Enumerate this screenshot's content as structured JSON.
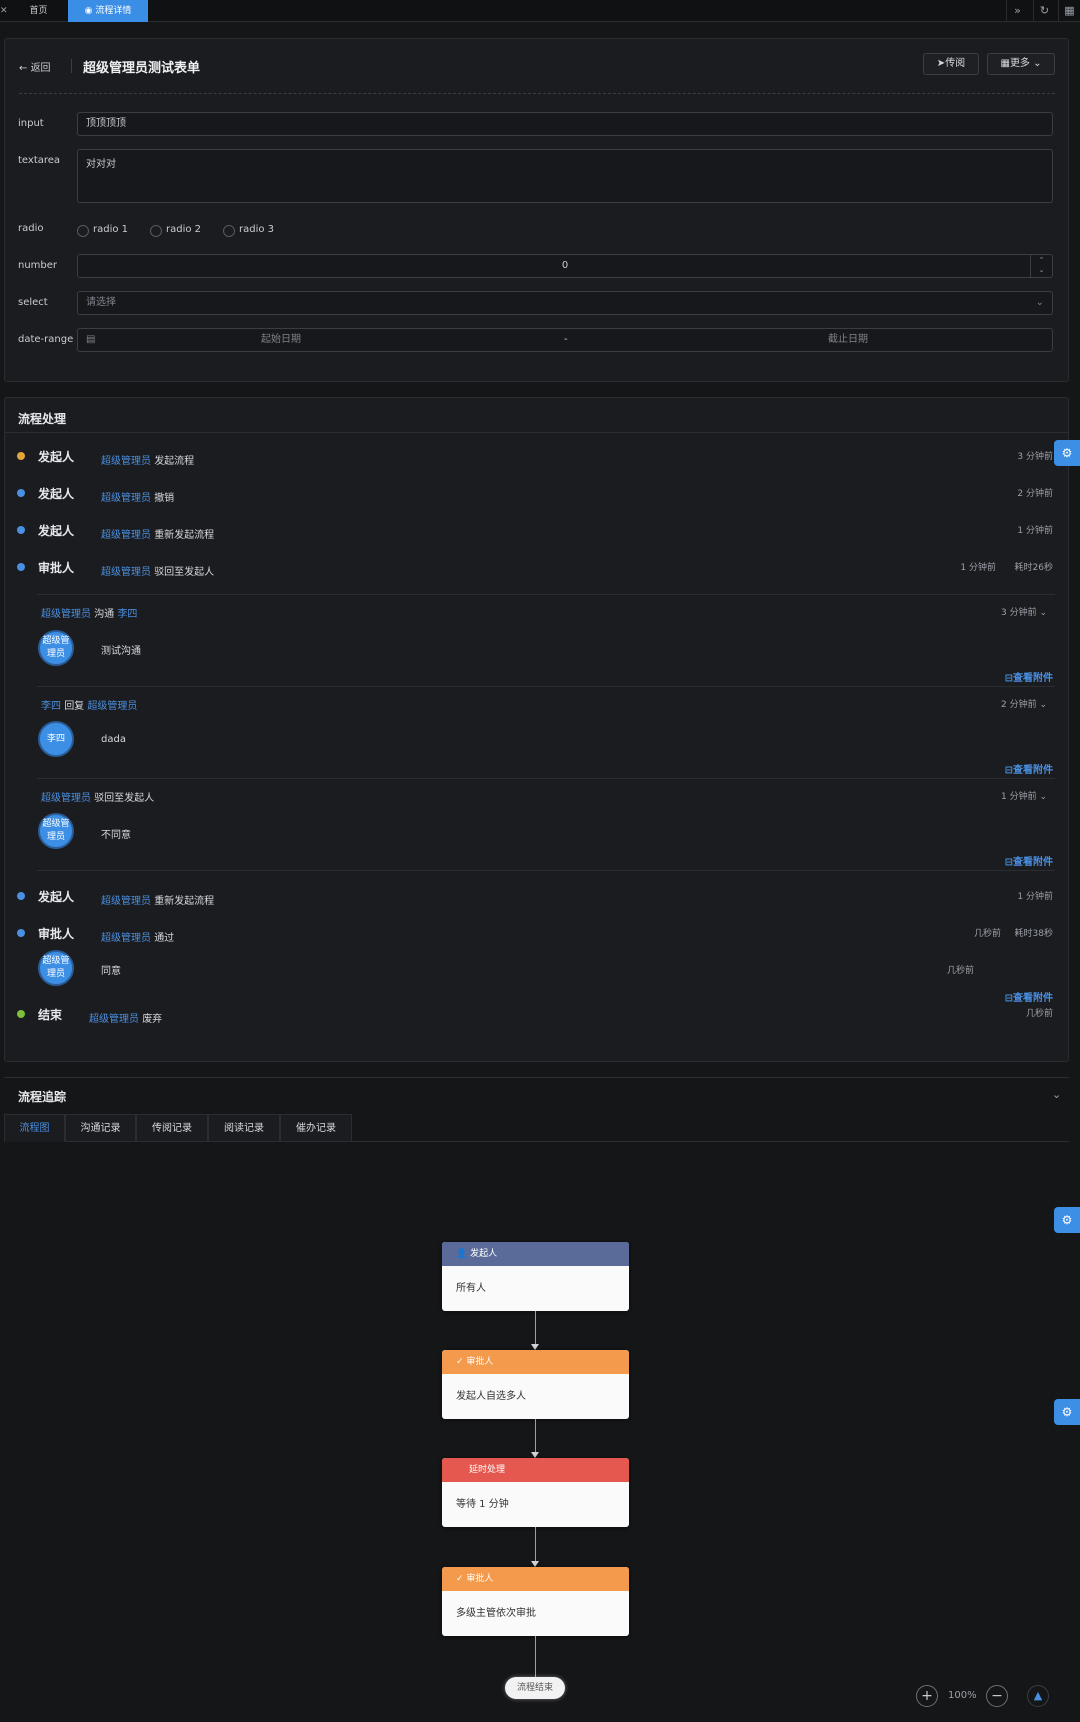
{
  "tabs": {
    "home": "首页",
    "active": "流程详情"
  },
  "header": {
    "back_label": "返回",
    "title": "超级管理员测试表单",
    "circulate_label": "传阅",
    "more_label": "更多"
  },
  "form": {
    "input": {
      "label": "input",
      "value": "顶顶顶顶"
    },
    "textarea": {
      "label": "textarea",
      "value": "对对对"
    },
    "radio": {
      "label": "radio",
      "options": [
        "radio 1",
        "radio 2",
        "radio 3"
      ]
    },
    "number": {
      "label": "number",
      "value": "0"
    },
    "select": {
      "label": "select",
      "placeholder": "请选择"
    },
    "date_range": {
      "label": "date-range",
      "start_placeholder": "起始日期",
      "separator": "-",
      "end_placeholder": "截止日期"
    }
  },
  "process": {
    "title": "流程处理",
    "attach_label": "查看附件",
    "entries": [
      {
        "role": "发起人",
        "user": "超级管理员",
        "action": "发起流程",
        "time": "3 分钟前",
        "color": "#e5a33b"
      },
      {
        "role": "发起人",
        "user": "超级管理员",
        "action": "撤销",
        "time": "2 分钟前",
        "color": "#4a90e2"
      },
      {
        "role": "发起人",
        "user": "超级管理员",
        "action": "重新发起流程",
        "time": "1 分钟前",
        "color": "#4a90e2"
      },
      {
        "role": "审批人",
        "user": "超级管理员",
        "action": "驳回至发起人",
        "time": "1 分钟前",
        "duration": "耗时26秒",
        "color": "#4a90e2"
      },
      {
        "role": "发起人",
        "user": "超级管理员",
        "action": "重新发起流程",
        "time": "1 分钟前",
        "color": "#4a90e2"
      },
      {
        "role": "审批人",
        "user": "超级管理员",
        "action": "通过",
        "time": "几秒前",
        "duration": "耗时38秒",
        "comment": "同意",
        "comment_time": "几秒前",
        "avatar": "超级管理员",
        "color": "#4a90e2"
      },
      {
        "role": "结束",
        "user": "超级管理员",
        "action": "废弃",
        "time": "几秒前",
        "color": "#7cbf3b"
      }
    ],
    "threads": [
      {
        "from": "超级管理员",
        "verb": "沟通",
        "to": "李四",
        "time": "3 分钟前",
        "avatar": "超级管理员",
        "text": "测试沟通"
      },
      {
        "from": "李四",
        "verb": "回复",
        "to": "超级管理员",
        "time": "2 分钟前",
        "avatar": "李四",
        "text": "dada"
      },
      {
        "from": "超级管理员",
        "verb": "驳回至发起人",
        "to": "",
        "time": "1 分钟前",
        "avatar": "超级管理员",
        "text": "不同意"
      }
    ]
  },
  "tracking": {
    "title": "流程追踪",
    "tabs": [
      "流程图",
      "沟通记录",
      "传阅记录",
      "阅读记录",
      "催办记录"
    ],
    "nodes": [
      {
        "type": "发起人",
        "body": "所有人",
        "color": "#5a6b9a"
      },
      {
        "type": "审批人",
        "body": "发起人自选多人",
        "color": "#f39a4c"
      },
      {
        "type": "延时处理",
        "body": "等待 1 分钟",
        "color": "#e5584f"
      },
      {
        "type": "审批人",
        "body": "多级主管依次审批",
        "color": "#f39a4c"
      }
    ],
    "end_label": "流程结束",
    "zoom": "100%"
  }
}
